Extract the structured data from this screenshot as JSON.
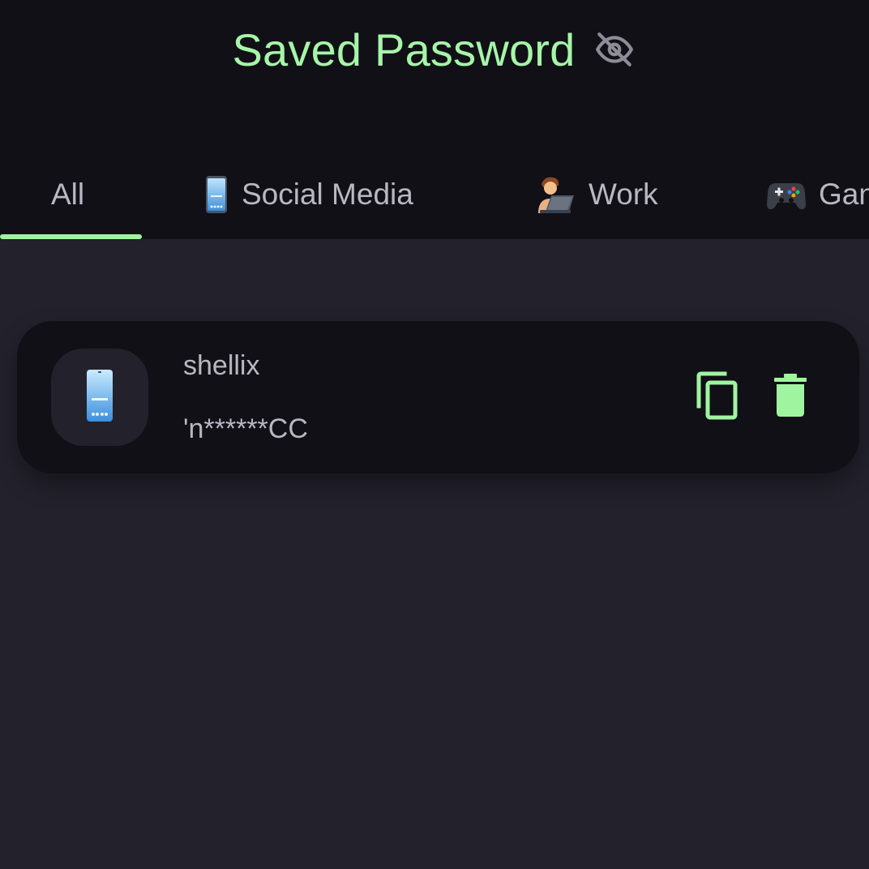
{
  "header": {
    "title": "Saved Password",
    "visibility_icon": "eye-off-icon"
  },
  "tabs": [
    {
      "label": "All",
      "icon": "",
      "selected": true
    },
    {
      "label": "Social Media",
      "icon": "mobile-phone-icon",
      "selected": false
    },
    {
      "label": "Work",
      "icon": "person-laptop-icon",
      "selected": false
    },
    {
      "label": "Gan",
      "icon": "game-controller-icon",
      "selected": false
    }
  ],
  "entries": [
    {
      "username": "shellix",
      "password_masked": "'n******CC",
      "category_icon": "mobile-phone-icon",
      "actions": [
        "copy-icon",
        "trash-icon"
      ]
    }
  ],
  "colors": {
    "accent": "#a6f5a8",
    "header_bg": "#111017",
    "body_bg": "#23222c",
    "text": "#b9b7c1"
  }
}
